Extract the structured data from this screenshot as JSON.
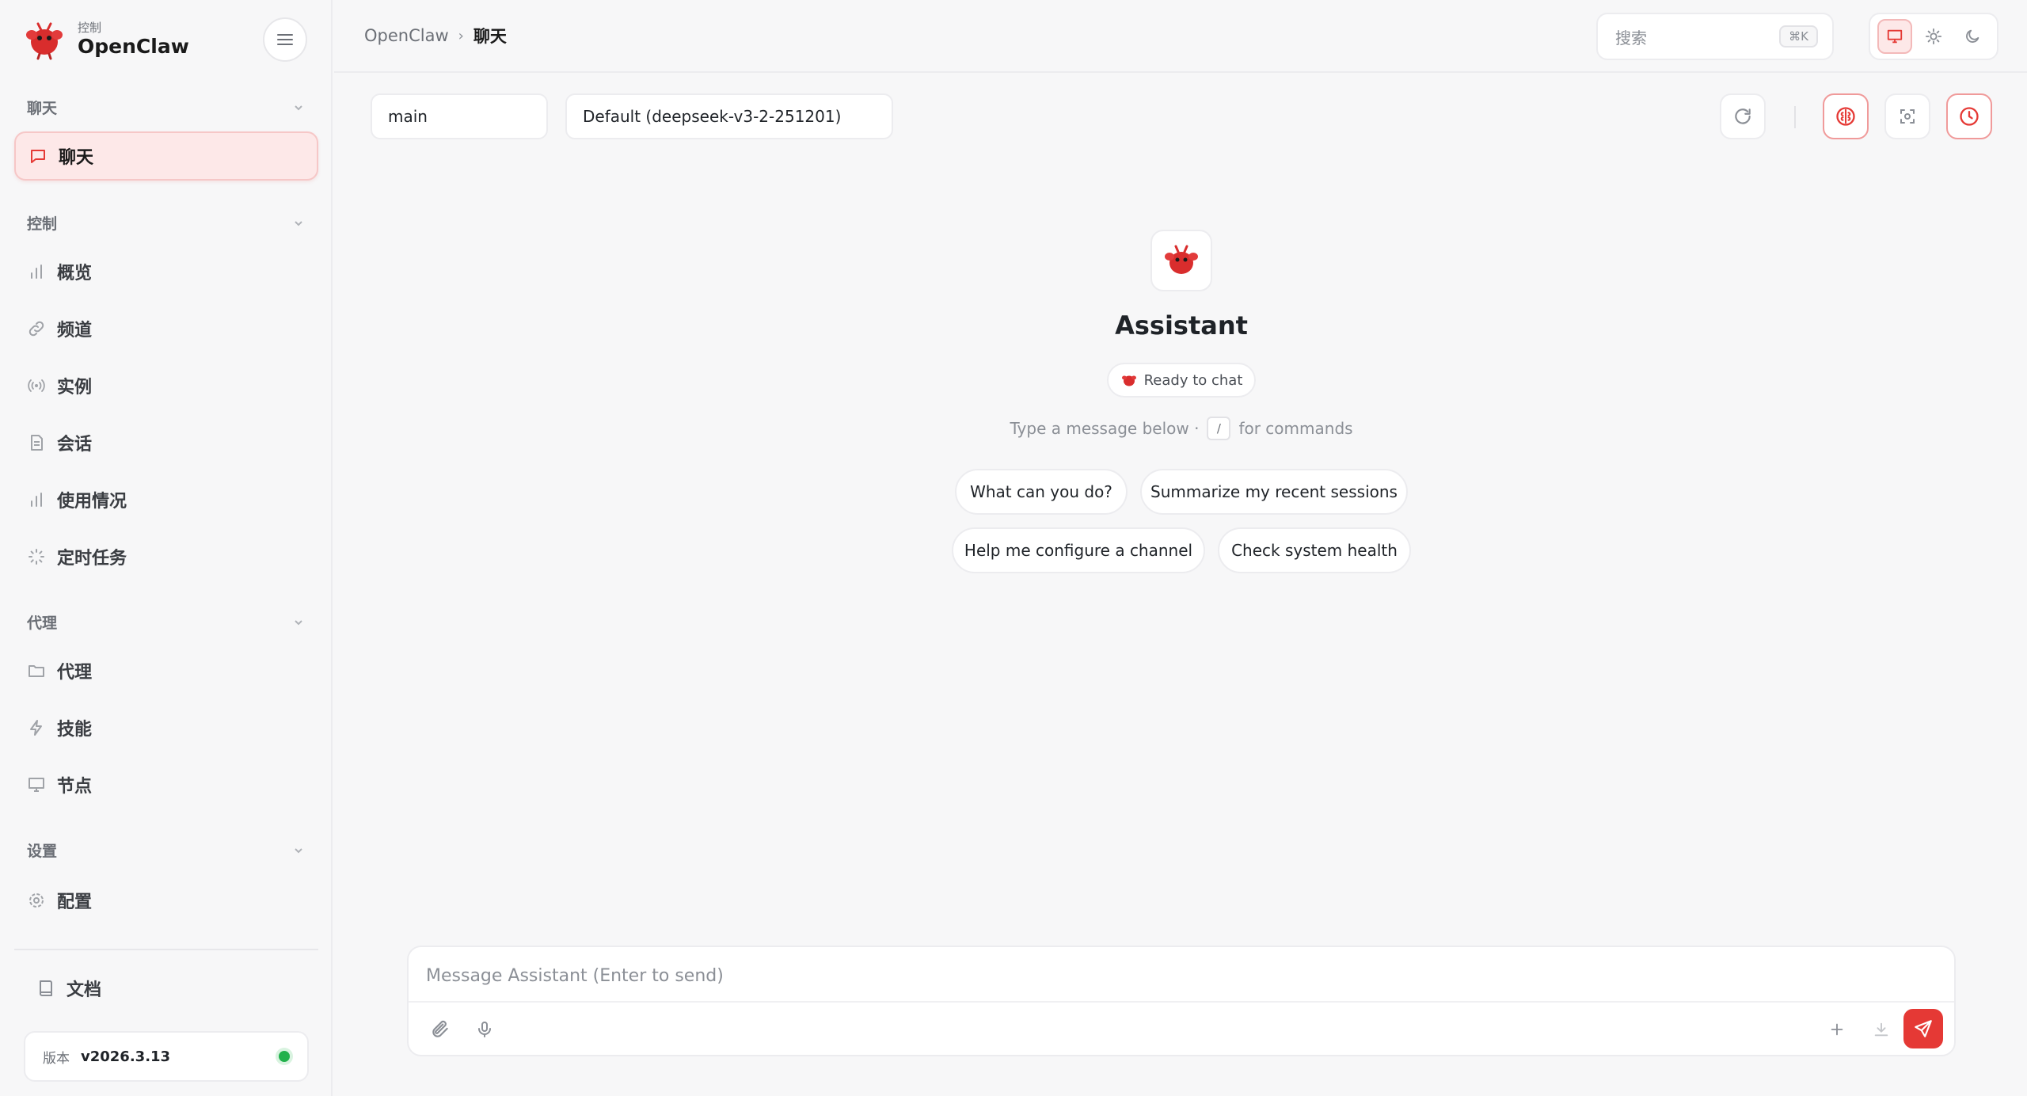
{
  "app": {
    "brand_sub": "控制",
    "brand_name": "OpenClaw"
  },
  "sidebar": {
    "sections": [
      {
        "label": "聊天",
        "items": [
          {
            "label": "聊天",
            "icon": "chat-bubble-icon",
            "active": true
          }
        ]
      },
      {
        "label": "控制",
        "items": [
          {
            "label": "概览",
            "icon": "bar-chart-icon"
          },
          {
            "label": "频道",
            "icon": "link-icon"
          },
          {
            "label": "实例",
            "icon": "radio-waves-icon"
          },
          {
            "label": "会话",
            "icon": "document-icon"
          },
          {
            "label": "使用情况",
            "icon": "bar-chart-icon"
          },
          {
            "label": "定时任务",
            "icon": "loader-icon"
          }
        ]
      },
      {
        "label": "代理",
        "items": [
          {
            "label": "代理",
            "icon": "folder-icon"
          },
          {
            "label": "技能",
            "icon": "lightning-icon"
          },
          {
            "label": "节点",
            "icon": "monitor-icon"
          }
        ]
      },
      {
        "label": "设置",
        "items": [
          {
            "label": "配置",
            "icon": "gear-icon"
          }
        ]
      }
    ],
    "docs_label": "文档",
    "version_label": "版本",
    "version_value": "v2026.3.13",
    "status_color": "#22b14c"
  },
  "header": {
    "breadcrumb_root": "OpenClaw",
    "breadcrumb_current": "聊天",
    "search_placeholder": "搜索",
    "search_shortcut": "⌘K"
  },
  "toolbar": {
    "session_value": "main",
    "model_value": "Default (deepseek-v3-2-251201)"
  },
  "welcome": {
    "title": "Assistant",
    "status": "Ready to chat",
    "hint_before": "Type a message below ·",
    "hint_key": "/",
    "hint_after": "for commands",
    "suggestions": [
      "What can you do?",
      "Summarize my recent sessions",
      "Help me configure a channel",
      "Check system health"
    ]
  },
  "composer": {
    "placeholder": "Message Assistant (Enter to send)"
  },
  "colors": {
    "accent": "#e53935",
    "accent_soft": "#fde8e8"
  }
}
